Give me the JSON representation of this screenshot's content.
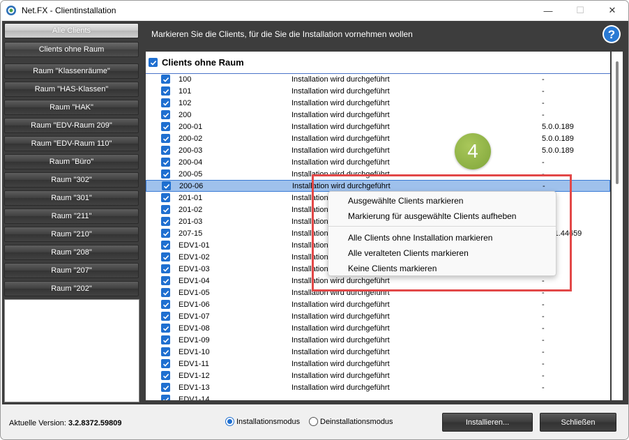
{
  "window": {
    "title": "Net.FX - Clientinstallation",
    "minimize": "—",
    "maximize": "☐",
    "close": "✕"
  },
  "sidebar": {
    "items": [
      {
        "label": "Alle Clients"
      },
      {
        "label": "Clients ohne Raum"
      },
      {
        "label": "Raum \"Klassenräume\""
      },
      {
        "label": "Raum \"HAS-Klassen\""
      },
      {
        "label": "Raum \"HAK\""
      },
      {
        "label": "Raum \"EDV-Raum 209\""
      },
      {
        "label": "Raum \"EDV-Raum 110\""
      },
      {
        "label": "Raum \"Büro\""
      },
      {
        "label": "Raum \"302\""
      },
      {
        "label": "Raum \"301\""
      },
      {
        "label": "Raum \"211\""
      },
      {
        "label": "Raum \"210\""
      },
      {
        "label": "Raum \"208\""
      },
      {
        "label": "Raum \"207\""
      },
      {
        "label": "Raum \"202\""
      }
    ]
  },
  "header": {
    "instruction": "Markieren Sie die Clients, für die Sie die Installation vornehmen wollen",
    "help": "?"
  },
  "list": {
    "group_title": "Clients ohne Raum",
    "rows": [
      {
        "name": "100",
        "status": "Installation wird durchgeführt",
        "version": "-"
      },
      {
        "name": "101",
        "status": "Installation wird durchgeführt",
        "version": "-"
      },
      {
        "name": "102",
        "status": "Installation wird durchgeführt",
        "version": "-"
      },
      {
        "name": "200",
        "status": "Installation wird durchgeführt",
        "version": "-"
      },
      {
        "name": "200-01",
        "status": "Installation wird durchgeführt",
        "version": "5.0.0.189"
      },
      {
        "name": "200-02",
        "status": "Installation wird durchgeführt",
        "version": "5.0.0.189"
      },
      {
        "name": "200-03",
        "status": "Installation wird durchgeführt",
        "version": "5.0.0.189"
      },
      {
        "name": "200-04",
        "status": "Installation wird durchgeführt",
        "version": "-"
      },
      {
        "name": "200-05",
        "status": "Installation wird durchgeführt",
        "version": "-"
      },
      {
        "name": "200-06",
        "status": "Installation wird durchgeführt",
        "version": "-"
      },
      {
        "name": "201-01",
        "status": "Installation",
        "version": ""
      },
      {
        "name": "201-02",
        "status": "Installation",
        "version": ""
      },
      {
        "name": "201-03",
        "status": "Installation",
        "version": ""
      },
      {
        "name": "207-15",
        "status": "Installation",
        "version": "3211.44659"
      },
      {
        "name": "EDV1-01",
        "status": "Installation",
        "version": ""
      },
      {
        "name": "EDV1-02",
        "status": "Installation",
        "version": ""
      },
      {
        "name": "EDV1-03",
        "status": "Installation",
        "version": ""
      },
      {
        "name": "EDV1-04",
        "status": "Installation wird durchgeführt",
        "version": "-"
      },
      {
        "name": "EDV1-05",
        "status": "Installation wird durchgeführt",
        "version": "-"
      },
      {
        "name": "EDV1-06",
        "status": "Installation wird durchgeführt",
        "version": "-"
      },
      {
        "name": "EDV1-07",
        "status": "Installation wird durchgeführt",
        "version": "-"
      },
      {
        "name": "EDV1-08",
        "status": "Installation wird durchgeführt",
        "version": "-"
      },
      {
        "name": "EDV1-09",
        "status": "Installation wird durchgeführt",
        "version": "-"
      },
      {
        "name": "EDV1-10",
        "status": "Installation wird durchgeführt",
        "version": "-"
      },
      {
        "name": "EDV1-11",
        "status": "Installation wird durchgeführt",
        "version": "-"
      },
      {
        "name": "EDV1-12",
        "status": "Installation wird durchgeführt",
        "version": "-"
      },
      {
        "name": "EDV1-13",
        "status": "Installation wird durchgeführt",
        "version": "-"
      },
      {
        "name": "EDV1-14",
        "status": "",
        "version": ""
      }
    ]
  },
  "context_menu": {
    "items": [
      "Ausgewählte Clients markieren",
      "Markierung für ausgewählte Clients aufheben",
      "Alle Clients ohne Installation markieren",
      "Alle veralteten Clients markieren",
      "Keine Clients markieren"
    ]
  },
  "callout": {
    "number": "4"
  },
  "footer": {
    "version_label": "Aktuelle Version:",
    "version_value": "3.2.8372.59809",
    "mode_install": "Installationsmodus",
    "mode_uninstall": "Deinstallationsmodus",
    "install_button": "Installieren...",
    "close_button": "Schließen"
  },
  "colors": {
    "accent": "#1f6fd0",
    "panel_dark": "#3d3d3d",
    "selection": "#9fc1ec",
    "highlight_red": "#e24848",
    "badge_green": "#8db545"
  }
}
